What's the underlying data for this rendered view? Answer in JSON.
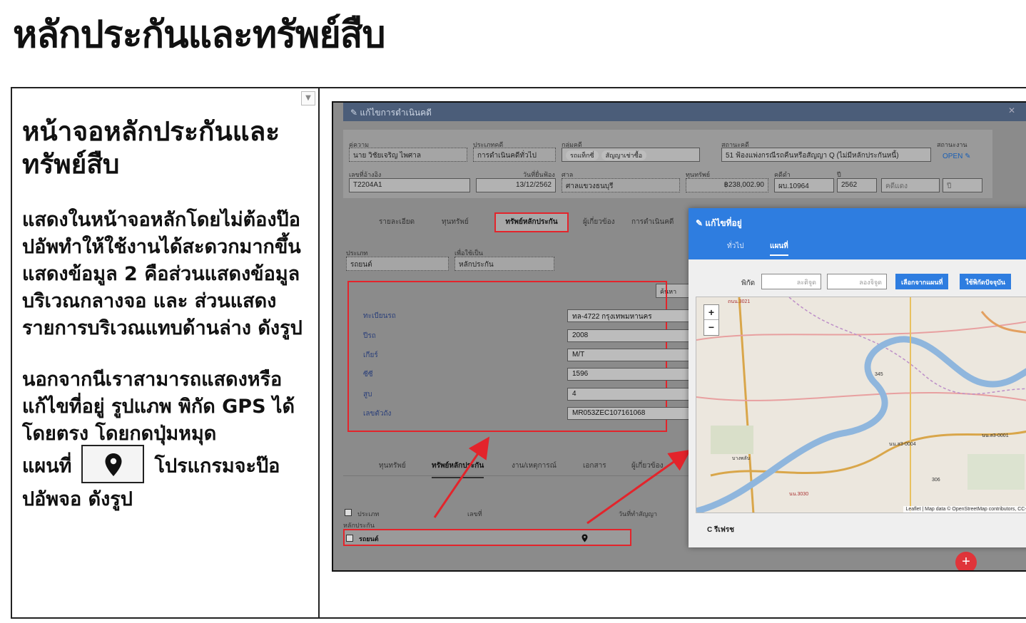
{
  "page": {
    "title": "หลักประกันและทรัพย์สืบ"
  },
  "left": {
    "heading": "หน้าจอหลักประกันและทรัพย์สืบ",
    "para1": "แสดงในหน้าจอหลักโดยไม่ต้องป๊อปอัพทำให้ใช้งานได้สะดวกมากขึ้น",
    "para2": "แสดงข้อมูล 2 คือส่วนแสดงข้อมูลบริเวณกลางจอ และ ส่วนแสดงรายการบริเวณแทบด้านล่าง  ดังรูป",
    "para3": "นอกจากนีเราสามารถแสดงหรือแก้ไขที่อยู่ รูปแภพ พิกัด GPS ได้โดยตรง โดยกดปุ่มหมุด",
    "para4a": "แผนที่",
    "para4b": "โปรแกรมจะป๊อปอัพจอ ดังรูป",
    "pin_icon": "map-pin-icon"
  },
  "shot": {
    "window_title": "✎ แก้ไขการดำเนินคดี",
    "close_glyph": "✕",
    "form": {
      "debtor_label": "คู่ความ",
      "debtor_value": "นาย วิชัยเจริญ  ไพศาล",
      "type_label": "ประเภทคดี",
      "type_value": "การดำเนินคดีทั่วไป",
      "group_label": "กลุ่มคดี",
      "group_chip1": "รถแท็กซี่",
      "group_chip2": "สัญญาเช่าซื้อ",
      "status_label": "สถานะคดี",
      "status_value": "51 ฟ้องแพ่งกรณีรถคืนหรือสัญญา Q (ไม่มีหลักประกันหนี้)",
      "job_status_label": "สถานะงาน",
      "job_status_value": "OPEN ✎",
      "ref_label": "เลขที่อ้างอิง",
      "ref_value": "T2204A1",
      "filed_label": "วันที่ยื่นฟ้อง",
      "filed_value": "13/12/2562",
      "court_label": "ศาล",
      "court_value": "ศาลแขวงธนบุรี",
      "capital_label": "ทุนทรัพย์",
      "capital_value": "฿238,002.90",
      "caseno_label": "คดีดำ",
      "caseno_value": "ผบ.10964",
      "year_label": "ปี",
      "year_value": "2562",
      "redcase_value": "คดีแดง",
      "redyear_value": "ปี"
    },
    "tabs": [
      "รายละเอียด",
      "ทุนทรัพย์",
      "ทรัพย์หลักประกัน",
      "ผู้เกี่ยวข้อง",
      "การดำเนินคดี"
    ],
    "collateral": {
      "type_label": "ประเภท",
      "type_value": "รถยนต์",
      "purpose_label": "เพื่อใช้เป็น",
      "purpose_value": "หลักประกัน",
      "search_btn": "ค้นหา",
      "rows": [
        {
          "label": "ทะเบียนรถ",
          "value": "ทล-4722 กรุงเทพมหานคร"
        },
        {
          "label": "ปีรถ",
          "value": "2008"
        },
        {
          "label": "เกียร์",
          "value": "M/T"
        },
        {
          "label": "ซีซี",
          "value": "1596"
        },
        {
          "label": "สูบ",
          "value": "4"
        },
        {
          "label": "เลขตัวถัง",
          "value": "MR053ZEC107161068"
        }
      ]
    },
    "bottom_tabs": [
      "ทุนทรัพย์",
      "ทรัพย์หลักประกัน",
      "งาน/เหตุการณ์",
      "เอกสาร",
      "ผู้เกี่ยวข้อง"
    ],
    "list": {
      "col_type": "ประเภท",
      "col_no": "เลขที่",
      "col_date": "วันที่ทำสัญญา",
      "group": "หลักประกัน",
      "row_value": "รถยนต์"
    },
    "fab": "+"
  },
  "map": {
    "title": "✎ แก้ไขที่อยู่",
    "tab_general": "ทั่วไป",
    "tab_map": "แผนที่",
    "coord_label": "พิกัด",
    "lat_placeholder": "ละติจูด",
    "lng_placeholder": "ลองจิจูด",
    "btn_pick": "เลือกจากแผนที่",
    "btn_current": "ใช้พิกัดปัจจุบัน",
    "zoom_in": "+",
    "zoom_out": "−",
    "attribution": "Leaflet | Map data © OpenStreetMap contributors, CC-BY-SA,",
    "refresh": "C  รีเฟรช",
    "road_labels": [
      "ถนน.3021",
      "345",
      "นน.ส3-0001",
      "นน.ส3-0004",
      "306",
      "บางพลับ",
      "นน.3030",
      "ถนน.3021"
    ]
  }
}
